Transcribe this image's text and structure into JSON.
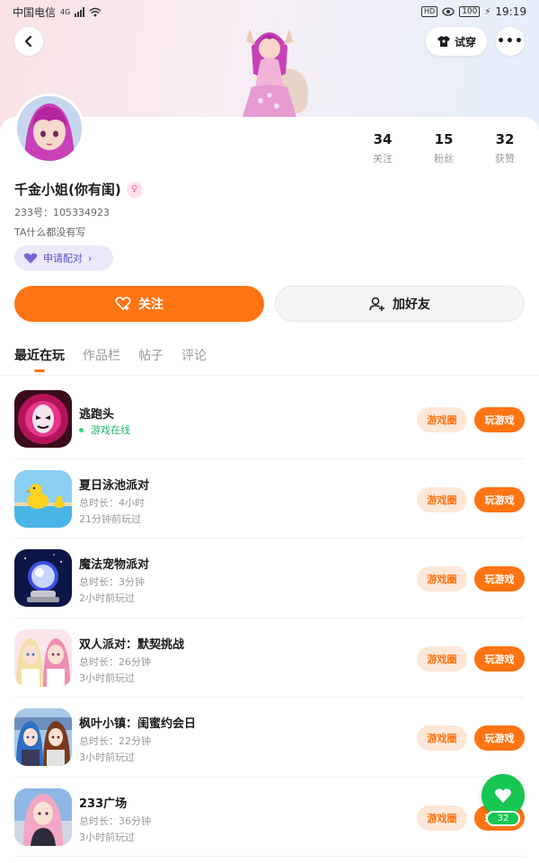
{
  "status_bar": {
    "carrier": "中国电信",
    "network": "4G",
    "hd_icon": "HD",
    "battery": "100",
    "time": "19:19"
  },
  "top": {
    "try_on_label": "试穿",
    "more_label": "•••"
  },
  "profile": {
    "name": "千金小姐(你有闺)",
    "id_line": "233号：105334923",
    "bio": "TA什么都没有写",
    "pair_label": "申请配对",
    "stats": [
      {
        "num": "34",
        "label": "关注"
      },
      {
        "num": "15",
        "label": "粉丝"
      },
      {
        "num": "32",
        "label": "获赞"
      }
    ],
    "follow_label": "关注",
    "add_friend_label": "加好友"
  },
  "tabs": [
    {
      "label": "最近在玩",
      "active": true
    },
    {
      "label": "作品栏",
      "active": false
    },
    {
      "label": "帖子",
      "active": false
    },
    {
      "label": "评论",
      "active": false
    }
  ],
  "games": [
    {
      "name": "逃跑头",
      "online": "游戏在线",
      "duration": "",
      "last_played": "",
      "icon": "mask-head-icon"
    },
    {
      "name": "夏日泳池派对",
      "online": "",
      "duration": "总时长：4小时",
      "last_played": "21分钟前玩过",
      "icon": "pool-duck-icon"
    },
    {
      "name": "魔法宠物派对",
      "online": "",
      "duration": "总时长：3分钟",
      "last_played": "2小时前玩过",
      "icon": "magic-orb-icon"
    },
    {
      "name": "双人派对：默契挑战",
      "online": "",
      "duration": "总时长：26分钟",
      "last_played": "3小时前玩过",
      "icon": "twin-girls-icon"
    },
    {
      "name": "枫叶小镇：闺蜜约会日",
      "online": "",
      "duration": "总时长：22分钟",
      "last_played": "3小时前玩过",
      "icon": "two-friends-icon"
    },
    {
      "name": "233广场",
      "online": "",
      "duration": "总时长：36分钟",
      "last_played": "3小时前玩过",
      "icon": "pink-hair-girl-icon"
    }
  ],
  "game_buttons": {
    "circle_label": "游戏圈",
    "play_label": "玩游戏"
  },
  "fab": {
    "count": "32"
  },
  "colors": {
    "accent": "#ff7413",
    "fab_green": "#17c653",
    "online_green": "#23b36b"
  }
}
